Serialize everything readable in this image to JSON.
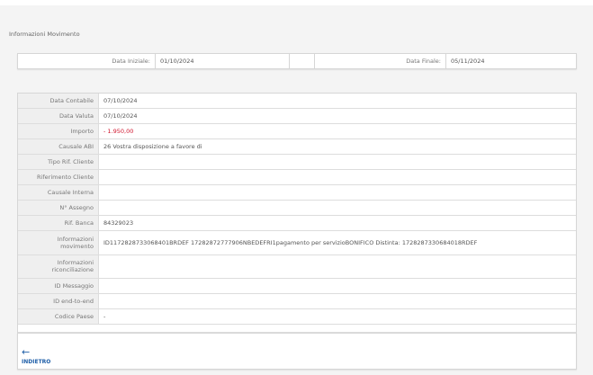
{
  "section_title": "Informazioni Movimento",
  "dates": {
    "start_label": "Data Iniziale:",
    "start_value": "01/10/2024",
    "end_label": "Data Finale:",
    "end_value": "05/11/2024"
  },
  "rows": [
    {
      "label": "Data Contabile",
      "value": "07/10/2024"
    },
    {
      "label": "Data Valuta",
      "value": "07/10/2024"
    },
    {
      "label": "Importo",
      "value": "- 1.950,00"
    },
    {
      "label": "Causale ABI",
      "value": "26 Vostra disposizione a favore di"
    },
    {
      "label": "Tipo Rif. Cliente",
      "value": ""
    },
    {
      "label": "Riferimento Cliente",
      "value": ""
    },
    {
      "label": "Causale Interna",
      "value": ""
    },
    {
      "label": "N° Assegno",
      "value": ""
    },
    {
      "label": "Rif. Banca",
      "value": "84329023"
    },
    {
      "label": "Informazioni movimento",
      "value": "ID1172828733068401BRDEF 17282872777906NBEDEFRI1pagamento per servizioBONIFICO Distinta: 1728287330684018RDEF"
    },
    {
      "label": "Informazioni riconciliazione",
      "value": ""
    },
    {
      "label": "ID Messaggio",
      "value": ""
    },
    {
      "label": "ID end-to-end",
      "value": ""
    },
    {
      "label": "Codice Paese",
      "value": "-"
    }
  ],
  "back": {
    "icon": "arrow-left-icon",
    "label": "INDIETRO"
  },
  "colors": {
    "negative": "#d0142c",
    "link": "#1f5fa8"
  }
}
